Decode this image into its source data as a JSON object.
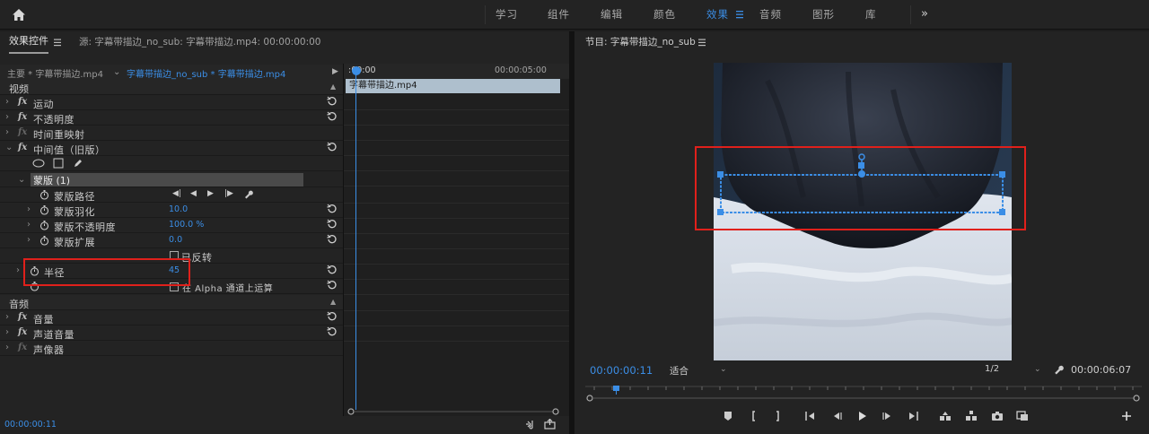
{
  "workspace_tabs": [
    {
      "label": "学习",
      "active": false
    },
    {
      "label": "组件",
      "active": false
    },
    {
      "label": "编辑",
      "active": false
    },
    {
      "label": "颜色",
      "active": false
    },
    {
      "label": "效果",
      "active": true
    },
    {
      "label": "音频",
      "active": false
    },
    {
      "label": "图形",
      "active": false
    },
    {
      "label": "库",
      "active": false
    }
  ],
  "effect_controls": {
    "tab_label": "效果控件",
    "source_label": "源: 字幕带描边_no_sub: 字幕带描边.mp4: 00:00:00:00",
    "clip_main": "主要 * 字幕带描边.mp4",
    "clip_sequence": "字幕带描边_no_sub * 字幕带描边.mp4",
    "video_section": "视频",
    "audio_section": "音频",
    "effects": {
      "motion": "运动",
      "opacity": "不透明度",
      "time_remap": "时间重映射",
      "median": "中间值（旧版）",
      "volume": "音量",
      "channel_volume": "声道音量",
      "panner": "声像器"
    },
    "mask": {
      "name": "蒙版 (1)",
      "path_label": "蒙版路径",
      "feather_label": "蒙版羽化",
      "feather_value": "10.0",
      "opacity_label": "蒙版不透明度",
      "opacity_value": "100.0 %",
      "expansion_label": "蒙版扩展",
      "expansion_value": "0.0",
      "inverted_label": "已反转"
    },
    "radius_label": "半径",
    "radius_value": "45",
    "alpha_label": "在 Alpha 通道上运算",
    "timeline": {
      "time_start": ":00:00",
      "time_5s": "00:00:05:00",
      "clip_name": "字幕带描边.mp4"
    },
    "current_time": "00:00:00:11"
  },
  "program_monitor": {
    "title": "节目: 字幕带描边_no_sub",
    "timecode": "00:00:00:11",
    "fit_label": "适合",
    "resolution": "1/2",
    "duration": "00:00:06:07"
  },
  "colors": {
    "accent": "#3b8ee6",
    "highlight": "#e0201b",
    "panel": "#232323"
  }
}
